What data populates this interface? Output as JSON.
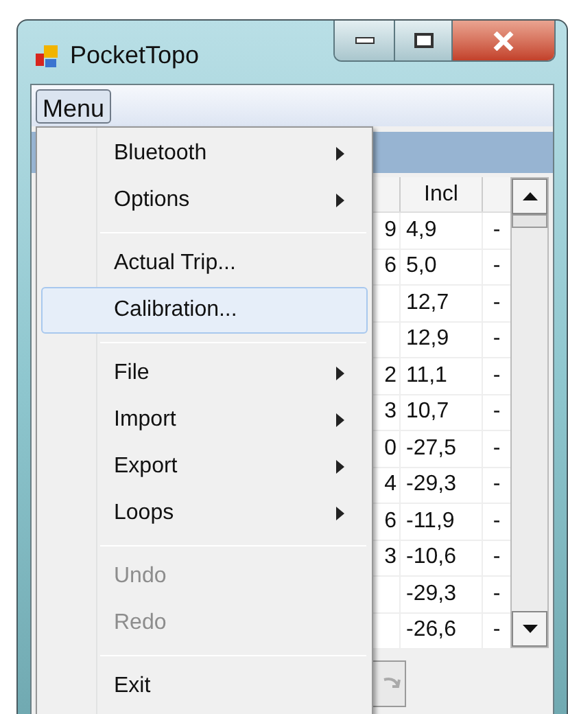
{
  "window": {
    "title": "PocketTopo"
  },
  "menu_bar": [
    {
      "label": "Menu",
      "selected": true
    }
  ],
  "menu": [
    {
      "kind": "item",
      "label": "Bluetooth",
      "submenu": true,
      "disabled": false,
      "selected": false
    },
    {
      "kind": "item",
      "label": "Options",
      "submenu": true,
      "disabled": false,
      "selected": false
    },
    {
      "kind": "separator"
    },
    {
      "kind": "item",
      "label": "Actual Trip...",
      "submenu": false,
      "disabled": false,
      "selected": false
    },
    {
      "kind": "item",
      "label": "Calibration...",
      "submenu": false,
      "disabled": false,
      "selected": true
    },
    {
      "kind": "separator"
    },
    {
      "kind": "item",
      "label": "File",
      "submenu": true,
      "disabled": false,
      "selected": false
    },
    {
      "kind": "item",
      "label": "Import",
      "submenu": true,
      "disabled": false,
      "selected": false
    },
    {
      "kind": "item",
      "label": "Export",
      "submenu": true,
      "disabled": false,
      "selected": false
    },
    {
      "kind": "item",
      "label": "Loops",
      "submenu": true,
      "disabled": false,
      "selected": false
    },
    {
      "kind": "separator"
    },
    {
      "kind": "item",
      "label": "Undo",
      "submenu": false,
      "disabled": true,
      "selected": false
    },
    {
      "kind": "item",
      "label": "Redo",
      "submenu": false,
      "disabled": true,
      "selected": false
    },
    {
      "kind": "separator"
    },
    {
      "kind": "item",
      "label": "Exit",
      "submenu": false,
      "disabled": false,
      "selected": false
    }
  ],
  "table": {
    "header": "Incl",
    "rows": [
      {
        "column_1": "9",
        "incl": "4,9",
        "column_3": "-"
      },
      {
        "column_1": "6",
        "incl": "5,0",
        "column_3": "-"
      },
      {
        "incl": "12,7",
        "column_3": "-"
      },
      {
        "incl": "12,9",
        "column_3": "-"
      },
      {
        "column_1": "2",
        "incl": "11,1",
        "column_3": "-"
      },
      {
        "column_1": "3",
        "incl": "10,7",
        "column_3": "-"
      },
      {
        "column_1": "0",
        "incl": "-27,5",
        "column_3": "-"
      },
      {
        "column_1": "4",
        "incl": "-29,3",
        "column_3": "-"
      },
      {
        "column_1": "6",
        "incl": "-11,9",
        "column_3": "-"
      },
      {
        "column_1": "3",
        "incl": "-10,6",
        "column_3": "-"
      },
      {
        "incl": "-29,3",
        "column_3": "-"
      },
      {
        "incl": "-26,6",
        "column_3": "-"
      }
    ]
  }
}
